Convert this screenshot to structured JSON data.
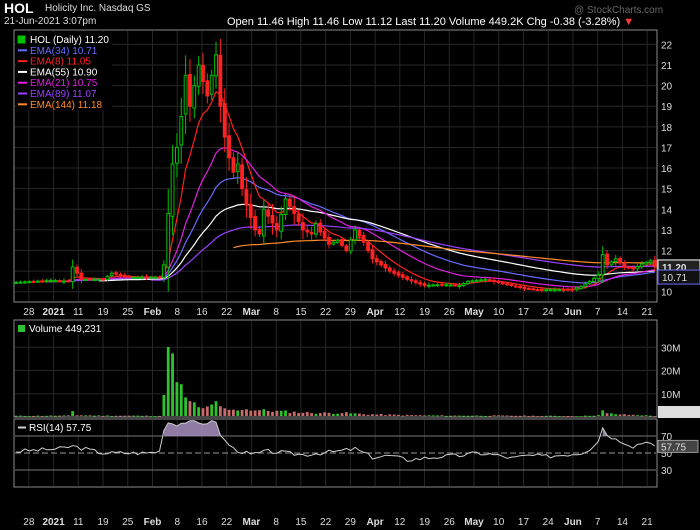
{
  "header": {
    "symbol": "HOL",
    "company": "Holicity Inc.",
    "exchange": "Nasdaq GS",
    "date": "21-Jun-2021 3:07pm",
    "open_label": "Open",
    "open": "11.46",
    "high_label": "High",
    "high": "11.46",
    "low_label": "Low",
    "low": "11.12",
    "last_label": "Last",
    "last": "11.20",
    "volume_label": "Volume",
    "volume": "449.2K",
    "chg_label": "Chg",
    "chg": "-0.38 (-3.28%)",
    "chg_arrow": "▼",
    "watermark": "@ StockCharts.com"
  },
  "chart_data": [
    {
      "type": "line",
      "panel": "price",
      "title": "HOL (Daily) 11.20",
      "ylim": [
        9.5,
        22.7
      ],
      "yticks": [
        10,
        11,
        12,
        13,
        14,
        15,
        16,
        17,
        18,
        19,
        20,
        21,
        22
      ],
      "y_axis_tags": [
        {
          "label": "11.20",
          "value": 11.2
        },
        {
          "label": "10.71",
          "value": 10.71
        }
      ],
      "legend_position": "top-left",
      "colors": {
        "up": "#00c000",
        "down": "#ff2020",
        "bg": "#000000",
        "grid": "#1e1e1e"
      },
      "series": [
        {
          "name": "HOL (Daily) 11.20",
          "type": "candlestick",
          "keypoints": [
            [
              0,
              10.45
            ],
            [
              8,
              10.55
            ],
            [
              12,
              10.5
            ],
            [
              13,
              11.2
            ],
            [
              15,
              10.6
            ],
            [
              20,
              10.6
            ],
            [
              22,
              10.9
            ],
            [
              24,
              10.8
            ],
            [
              26,
              10.7
            ],
            [
              33,
              10.7
            ],
            [
              34,
              11.3
            ],
            [
              35,
              13.8
            ],
            [
              36,
              16.2
            ],
            [
              37,
              17.0
            ],
            [
              38,
              18.5
            ],
            [
              39,
              20.5
            ],
            [
              40,
              19.0
            ],
            [
              41,
              20.0
            ],
            [
              42,
              21.0
            ],
            [
              43,
              20.2
            ],
            [
              44,
              19.5
            ],
            [
              45,
              20.5
            ],
            [
              46,
              21.5
            ],
            [
              47,
              19.0
            ],
            [
              48,
              17.5
            ],
            [
              49,
              16.5
            ],
            [
              50,
              15.8
            ],
            [
              51,
              16.2
            ],
            [
              52,
              15.0
            ],
            [
              53,
              14.2
            ],
            [
              54,
              13.6
            ],
            [
              55,
              13.0
            ],
            [
              56,
              12.8
            ],
            [
              57,
              14.0
            ],
            [
              60,
              13.0
            ],
            [
              62,
              14.5
            ],
            [
              64,
              13.8
            ],
            [
              66,
              13.0
            ],
            [
              68,
              12.8
            ],
            [
              69,
              13.3
            ],
            [
              70,
              12.9
            ],
            [
              72,
              12.3
            ],
            [
              74,
              12.5
            ],
            [
              76,
              12.0
            ],
            [
              78,
              13.0
            ],
            [
              80,
              12.4
            ],
            [
              82,
              11.6
            ],
            [
              84,
              11.3
            ],
            [
              86,
              11.0
            ],
            [
              90,
              10.6
            ],
            [
              94,
              10.3
            ],
            [
              98,
              10.35
            ],
            [
              102,
              10.3
            ],
            [
              104,
              10.5
            ],
            [
              108,
              10.6
            ],
            [
              112,
              10.4
            ],
            [
              116,
              10.2
            ],
            [
              120,
              10.1
            ],
            [
              124,
              10.1
            ],
            [
              128,
              10.1
            ],
            [
              130,
              10.25
            ],
            [
              132,
              10.5
            ],
            [
              134,
              10.8
            ],
            [
              135,
              11.8
            ],
            [
              136,
              11.3
            ],
            [
              138,
              11.6
            ],
            [
              140,
              11.2
            ],
            [
              142,
              11.1
            ],
            [
              144,
              11.35
            ],
            [
              146,
              11.5
            ],
            [
              147,
              11.2
            ]
          ]
        },
        {
          "name": "EMA(34) 10.71",
          "color": "#6a6aff"
        },
        {
          "name": "EMA(8) 11.05",
          "color": "#ff2020"
        },
        {
          "name": "EMA(55) 10.90",
          "color": "#ffffff"
        },
        {
          "name": "EMA(21) 10.75",
          "color": "#e020e0"
        },
        {
          "name": "EMA(89) 11.07",
          "color": "#9a40ff"
        },
        {
          "name": "EMA(144) 11.18",
          "color": "#ff8a2a"
        }
      ]
    },
    {
      "type": "bar",
      "panel": "volume",
      "title": "Volume 449,231",
      "ylim": [
        0,
        40
      ],
      "y_unit": "M",
      "ytick_labels": [
        "10M",
        "20M",
        "30M"
      ],
      "yticks": [
        10,
        20,
        30
      ],
      "value_tag": "449231",
      "keypoints": [
        [
          0,
          0.5
        ],
        [
          12,
          0.6
        ],
        [
          13,
          2.5
        ],
        [
          14,
          0.8
        ],
        [
          20,
          0.6
        ],
        [
          33,
          0.5
        ],
        [
          34,
          8.0
        ],
        [
          35,
          38.0
        ],
        [
          36,
          24.0
        ],
        [
          37,
          14.0
        ],
        [
          38,
          12.0
        ],
        [
          39,
          9.0
        ],
        [
          40,
          6.0
        ],
        [
          41,
          5.5
        ],
        [
          42,
          4.0
        ],
        [
          43,
          3.5
        ],
        [
          44,
          5.0
        ],
        [
          45,
          4.5
        ],
        [
          46,
          6.0
        ],
        [
          47,
          4.0
        ],
        [
          48,
          3.5
        ],
        [
          50,
          2.8
        ],
        [
          52,
          3.5
        ],
        [
          55,
          3.0
        ],
        [
          60,
          2.5
        ],
        [
          65,
          2.0
        ],
        [
          70,
          1.7
        ],
        [
          75,
          1.8
        ],
        [
          80,
          1.2
        ],
        [
          90,
          0.8
        ],
        [
          100,
          0.6
        ],
        [
          110,
          0.6
        ],
        [
          120,
          0.5
        ],
        [
          130,
          0.4
        ],
        [
          134,
          0.8
        ],
        [
          135,
          2.5
        ],
        [
          136,
          1.5
        ],
        [
          140,
          1.0
        ],
        [
          144,
          0.8
        ],
        [
          147,
          0.45
        ]
      ]
    },
    {
      "type": "line",
      "panel": "rsi",
      "title": "RSI(14) 57.75",
      "ylim": [
        10,
        90
      ],
      "yticks": [
        30,
        50,
        70
      ],
      "ytick_labels": [
        "30",
        "50",
        "70"
      ],
      "value_tag": "57.75",
      "keypoints": [
        [
          0,
          52
        ],
        [
          10,
          55
        ],
        [
          13,
          58
        ],
        [
          20,
          50
        ],
        [
          30,
          50
        ],
        [
          33,
          52
        ],
        [
          34,
          79
        ],
        [
          35,
          86
        ],
        [
          37,
          84
        ],
        [
          40,
          88
        ],
        [
          42,
          85
        ],
        [
          44,
          86
        ],
        [
          46,
          88
        ],
        [
          47,
          70
        ],
        [
          50,
          55
        ],
        [
          54,
          48
        ],
        [
          58,
          52
        ],
        [
          62,
          50
        ],
        [
          66,
          48
        ],
        [
          70,
          50
        ],
        [
          74,
          52
        ],
        [
          78,
          55
        ],
        [
          82,
          45
        ],
        [
          86,
          47
        ],
        [
          90,
          42
        ],
        [
          94,
          44
        ],
        [
          98,
          46
        ],
        [
          102,
          47
        ],
        [
          106,
          50
        ],
        [
          110,
          48
        ],
        [
          114,
          44
        ],
        [
          118,
          47
        ],
        [
          122,
          46
        ],
        [
          126,
          48
        ],
        [
          130,
          50
        ],
        [
          132,
          55
        ],
        [
          134,
          65
        ],
        [
          135,
          80
        ],
        [
          136,
          72
        ],
        [
          138,
          66
        ],
        [
          140,
          63
        ],
        [
          142,
          58
        ],
        [
          144,
          62
        ],
        [
          146,
          64
        ],
        [
          147,
          58
        ]
      ]
    },
    {
      "type": "axis",
      "panel": "dates",
      "xtick_labels": [
        "28",
        "2021",
        "11",
        "19",
        "25",
        "Feb",
        "8",
        "16",
        "22",
        "Mar",
        "8",
        "15",
        "22",
        "29",
        "Apr",
        "12",
        "19",
        "26",
        "May",
        "10",
        "17",
        "24",
        "Jun",
        "7",
        "14",
        "21"
      ],
      "xtick_positions": [
        3,
        8,
        13,
        18,
        23,
        28,
        33,
        38,
        43,
        48,
        53,
        58,
        63,
        68,
        73,
        78,
        83,
        88,
        93,
        98,
        103,
        108,
        113,
        118,
        123,
        128
      ]
    }
  ]
}
